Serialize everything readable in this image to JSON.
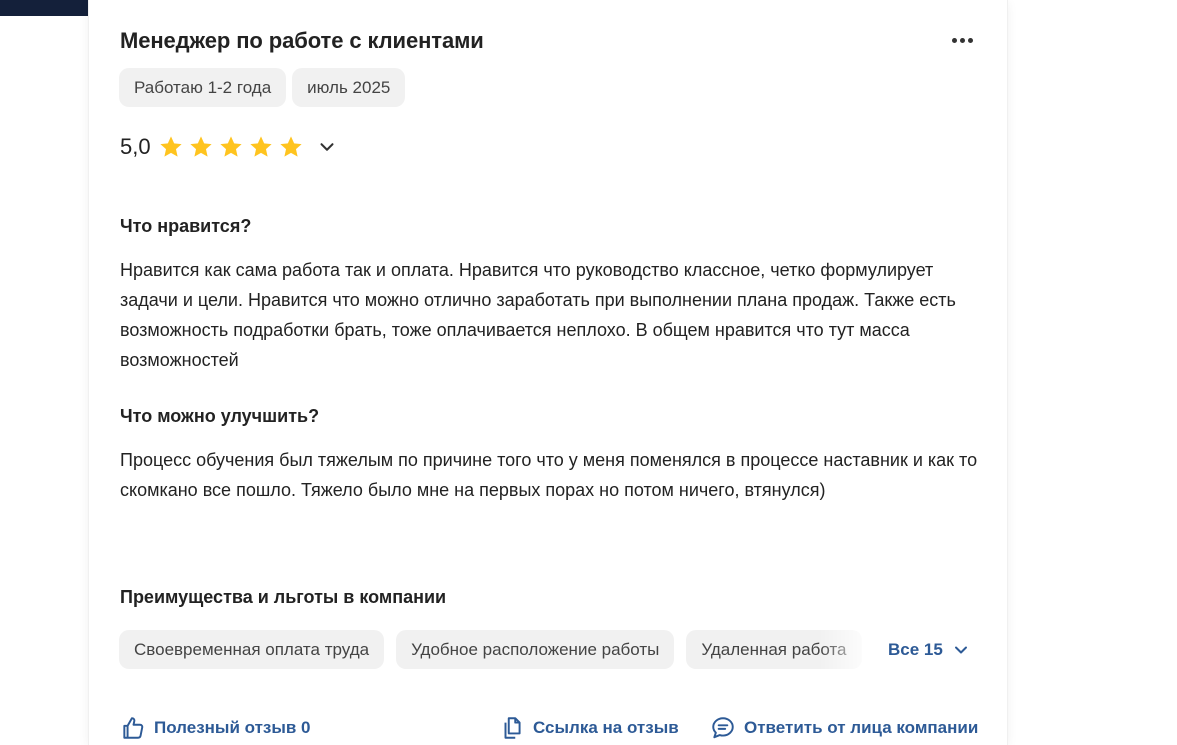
{
  "review": {
    "title": "Менеджер по работе с клиентами",
    "tags": [
      "Работаю 1-2 года",
      "июль 2025"
    ],
    "rating": {
      "value_label": "5,0",
      "stars_filled": 5,
      "stars_total": 5,
      "star_color": "#ffc41f"
    },
    "likes": {
      "heading": "Что нравится?",
      "text": "Нравится как сама работа так и оплата. Нравится что руководство классное, четко формулирует задачи и цели. Нравится что можно отлично заработать при выполнении плана продаж. Также есть возможность подработки брать, тоже оплачивается неплохо. В общем нравится что тут масса возможностей"
    },
    "improve": {
      "heading": "Что можно улучшить?",
      "text": "Процесс обучения был тяжелым по причине того что у меня поменялся в процессе наставник и как то скомкано все пошло. Тяжело было мне на первых порах но потом ничего, втянулся)"
    },
    "benefits": {
      "heading": "Преимущества и льготы в компании",
      "items": [
        "Своевременная оплата труда",
        "Удобное расположение работы",
        "Удаленная работа"
      ],
      "all_label": "Все 15"
    },
    "actions": {
      "helpful_label": "Полезный отзыв 0",
      "link_label": "Ссылка на отзыв",
      "reply_label": "Ответить от лица компании"
    }
  },
  "colors": {
    "accent": "#2d5a96",
    "chip_bg": "#f1f1f1",
    "header_dark": "#14203a"
  },
  "icons": {
    "more": "more-horizontal-icon",
    "star": "star-icon",
    "chevron": "chevron-down-icon",
    "like": "thumbs-up-icon",
    "copy": "copy-link-icon",
    "reply": "chat-bubble-icon"
  }
}
